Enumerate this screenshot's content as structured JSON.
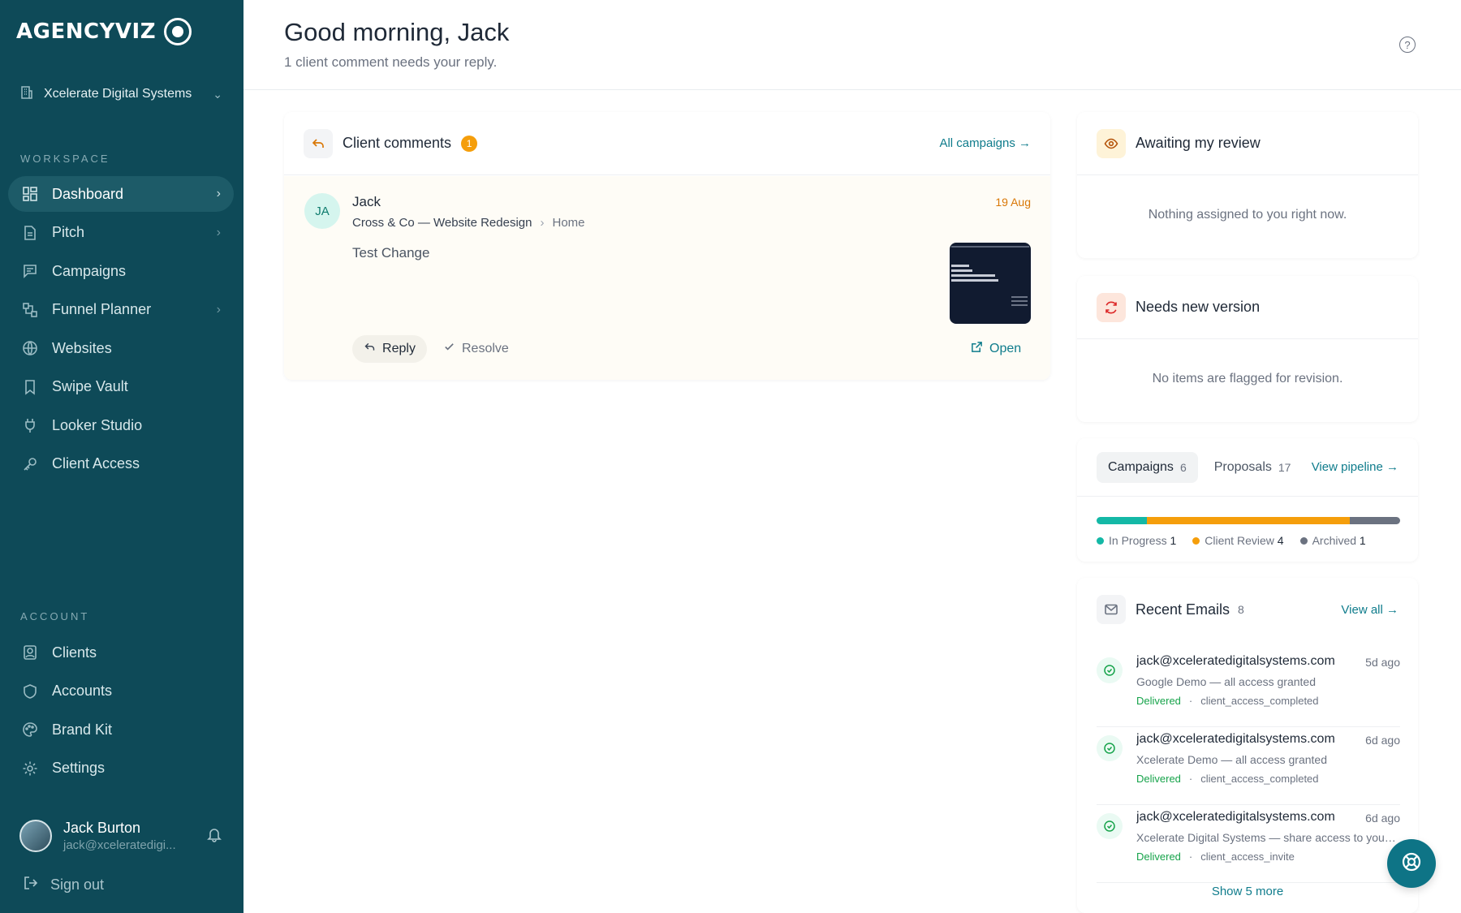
{
  "brand": {
    "name": "AGENCYVIZ"
  },
  "org": {
    "name": "Xcelerate Digital Systems"
  },
  "sidebar": {
    "workspace_label": "WORKSPACE",
    "account_label": "ACCOUNT",
    "workspace_items": [
      {
        "label": "Dashboard",
        "icon": "dashboard-icon",
        "active": true,
        "has_arrow": true
      },
      {
        "label": "Pitch",
        "icon": "document-icon",
        "has_arrow": true
      },
      {
        "label": "Campaigns",
        "icon": "message-icon"
      },
      {
        "label": "Funnel Planner",
        "icon": "funnel-icon",
        "has_arrow": true
      },
      {
        "label": "Websites",
        "icon": "globe-icon"
      },
      {
        "label": "Swipe Vault",
        "icon": "bookmark-icon"
      },
      {
        "label": "Looker Studio",
        "icon": "plug-icon"
      },
      {
        "label": "Client Access",
        "icon": "key-icon"
      }
    ],
    "account_items": [
      {
        "label": "Clients",
        "icon": "contact-icon"
      },
      {
        "label": "Accounts",
        "icon": "shield-icon"
      },
      {
        "label": "Brand Kit",
        "icon": "palette-icon"
      },
      {
        "label": "Settings",
        "icon": "gear-icon"
      }
    ],
    "user": {
      "name": "Jack Burton",
      "email": "jack@xceleratedigi..."
    },
    "sign_out": "Sign out"
  },
  "header": {
    "greeting": "Good morning, Jack",
    "subtitle": "1 client comment needs your reply."
  },
  "client_comments": {
    "title": "Client comments",
    "badge": "1",
    "link": "All campaigns →",
    "comment": {
      "initials": "JA",
      "author": "Jack",
      "campaign": "Cross & Co — Website Redesign",
      "page": "Home",
      "date": "19 Aug",
      "text": "Test Change",
      "reply": "Reply",
      "resolve": "Resolve",
      "open": "Open"
    }
  },
  "awaiting_review": {
    "title": "Awaiting my review",
    "empty": "Nothing assigned to you right now."
  },
  "needs_version": {
    "title": "Needs new version",
    "empty": "No items are flagged for revision."
  },
  "pipeline": {
    "tabs": [
      {
        "label": "Campaigns",
        "count": "6",
        "active": true
      },
      {
        "label": "Proposals",
        "count": "17"
      }
    ],
    "link": "View pipeline →",
    "segments": [
      {
        "label": "In Progress",
        "count": "1",
        "value": 1,
        "color": "#14b8a6"
      },
      {
        "label": "Client Review",
        "count": "4",
        "value": 4,
        "color": "#f59e0b"
      },
      {
        "label": "Archived",
        "count": "1",
        "value": 1,
        "color": "#6b7280"
      }
    ]
  },
  "emails": {
    "title": "Recent Emails",
    "count": "8",
    "link": "View all →",
    "items": [
      {
        "address": "jack@xceleratedigitalsystems.com",
        "ago": "5d ago",
        "subject": "Google Demo — all access granted",
        "status": "Delivered",
        "event": "client_access_completed"
      },
      {
        "address": "jack@xceleratedigitalsystems.com",
        "ago": "6d ago",
        "subject": "Xcelerate Demo — all access granted",
        "status": "Delivered",
        "event": "client_access_completed"
      },
      {
        "address": "jack@xceleratedigitalsystems.com",
        "ago": "6d ago",
        "subject": "Xcelerate Digital Systems — share access to your accounts",
        "status": "Delivered",
        "event": "client_access_invite"
      }
    ],
    "show_more": "Show 5 more"
  },
  "colors": {
    "sidebar_bg": "#0e4a58",
    "accent": "#0f7c8c",
    "warning": "#f59e0b"
  }
}
